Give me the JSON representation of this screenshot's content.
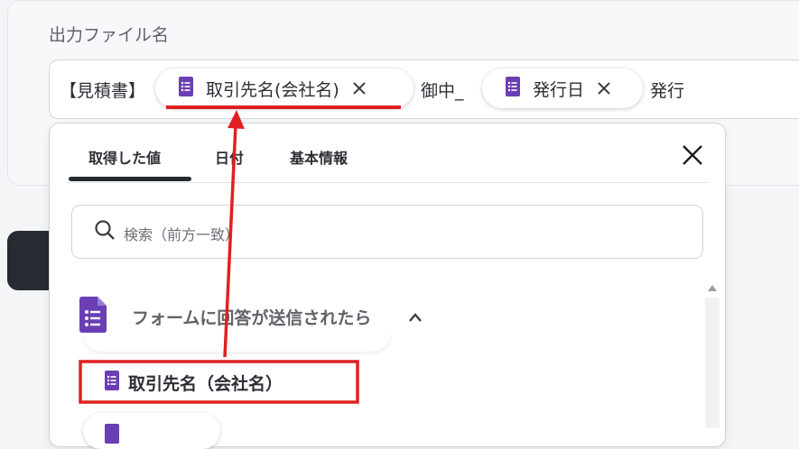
{
  "field": {
    "label": "出力ファイル名",
    "prefix": "【見積書】",
    "middle": "御中_",
    "suffix": "発行",
    "chips": [
      {
        "label": "取引先名(会社名)",
        "icon": "google-forms-icon"
      },
      {
        "label": "発行日",
        "icon": "google-forms-icon"
      }
    ]
  },
  "dropdown": {
    "tabs": [
      {
        "label": "取得した値",
        "active": true
      },
      {
        "label": "日付",
        "active": false
      },
      {
        "label": "基本情報",
        "active": false
      }
    ],
    "search_placeholder": "検索（前方一致）",
    "section": {
      "title": "フォームに回答が送信されたら",
      "icon": "google-forms-icon",
      "expanded": true
    },
    "items": [
      {
        "label": "取引先名（会社名）",
        "icon": "google-forms-icon",
        "highlighted": true
      }
    ]
  },
  "colors": {
    "forms_purple": "#6a3fb5",
    "annotation_red": "#e02020",
    "dark_button": "#262a31"
  }
}
